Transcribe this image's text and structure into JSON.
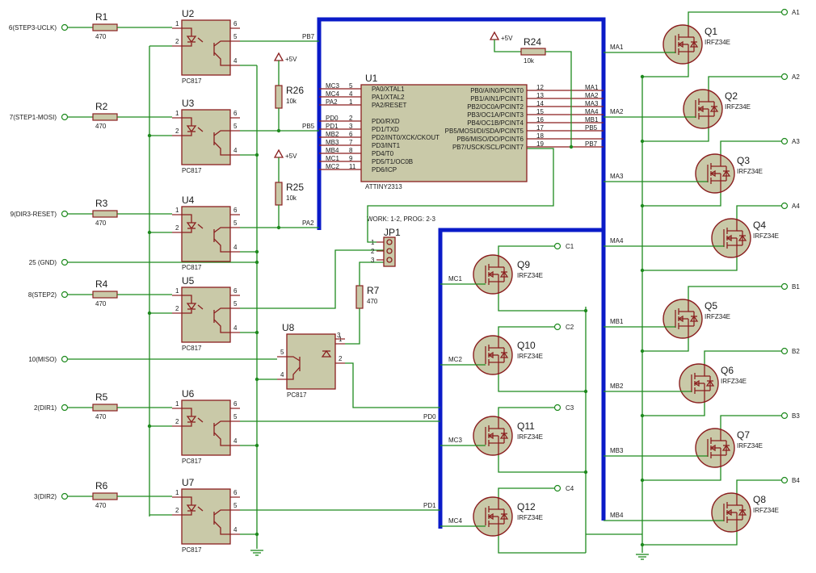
{
  "left_inputs": [
    "6(STEP3-UCLK)",
    "7(STEP1-MOSI)",
    "9(DIR3-RESET)",
    "25 (GND)",
    "8(STEP2)",
    "10(MISO)",
    "2(DIR1)",
    "3(DIR2)"
  ],
  "resistors": [
    {
      "ref": "R1",
      "value": "470"
    },
    {
      "ref": "R2",
      "value": "470"
    },
    {
      "ref": "R3",
      "value": "470"
    },
    {
      "ref": "R4",
      "value": "470"
    },
    {
      "ref": "R5",
      "value": "470"
    },
    {
      "ref": "R6",
      "value": "470"
    },
    {
      "ref": "R26",
      "value": "10k"
    },
    {
      "ref": "R25",
      "value": "10k"
    },
    {
      "ref": "R24",
      "value": "10k"
    },
    {
      "ref": "R7",
      "value": "470"
    }
  ],
  "optos": [
    {
      "ref": "U2",
      "part": "PC817"
    },
    {
      "ref": "U3",
      "part": "PC817"
    },
    {
      "ref": "U4",
      "part": "PC817"
    },
    {
      "ref": "U5",
      "part": "PC817"
    },
    {
      "ref": "U6",
      "part": "PC817"
    },
    {
      "ref": "U7",
      "part": "PC817"
    },
    {
      "ref": "U8",
      "part": "PC817"
    }
  ],
  "opto_pins": [
    "1",
    "2",
    "6",
    "5",
    "4",
    "3"
  ],
  "supply": "+5V",
  "mcu": {
    "ref": "U1",
    "part": "ATTINY2313",
    "left_pins": [
      {
        "net": "MC3",
        "num": "5",
        "name": "PA0/XTAL1"
      },
      {
        "net": "MC4",
        "num": "4",
        "name": "PA1/XTAL2"
      },
      {
        "net": "PA2",
        "num": "1",
        "name": "PA2/RESET"
      },
      {
        "net": "PD0",
        "num": "2",
        "name": "PD0/RXD"
      },
      {
        "net": "PD1",
        "num": "3",
        "name": "PD1/TXD"
      },
      {
        "net": "MB2",
        "num": "6",
        "name": "PD2/INT0/XCK/CKOUT"
      },
      {
        "net": "MB3",
        "num": "7",
        "name": "PD3/INT1"
      },
      {
        "net": "MB4",
        "num": "8",
        "name": "PD4/T0"
      },
      {
        "net": "MC1",
        "num": "9",
        "name": "PD5/T1/OC0B"
      },
      {
        "net": "MC2",
        "num": "11",
        "name": "PD6/ICP"
      }
    ],
    "right_pins": [
      {
        "num": "12",
        "name": "PB0/AIN0/PCINT0",
        "net": "MA1"
      },
      {
        "num": "13",
        "name": "PB1/AIN1/PCINT1",
        "net": "MA2"
      },
      {
        "num": "14",
        "name": "PB2/OC0A/PCINT2",
        "net": "MA3"
      },
      {
        "num": "15",
        "name": "PB3/OC1A/PCINT3",
        "net": "MA4"
      },
      {
        "num": "16",
        "name": "PB4/OC1B/PCINT4",
        "net": "MB1"
      },
      {
        "num": "17",
        "name": "PB5/MOSI/DI/SDA/PCINT5",
        "net": "PB5"
      },
      {
        "num": "18",
        "name": "PB6/MISO/DO/PCINT6",
        "net": ""
      },
      {
        "num": "19",
        "name": "PB7/USCK/SCL/PCINT7",
        "net": "PB7"
      }
    ]
  },
  "net_labels": {
    "pb7": "PB7",
    "pb5": "PB5",
    "pa2": "PA2",
    "pd0": "PD0",
    "pd1": "PD1"
  },
  "jumper": {
    "ref": "JP1",
    "note": "WORK: 1-2, PROG: 2-3",
    "pins": [
      "1",
      "2",
      "3"
    ]
  },
  "mosfets_right": [
    {
      "ref": "Q1",
      "part": "IRFZ34E",
      "gate": "MA1",
      "out": "A1"
    },
    {
      "ref": "Q2",
      "part": "IRFZ34E",
      "gate": "MA2",
      "out": "A2"
    },
    {
      "ref": "Q3",
      "part": "IRFZ34E",
      "gate": "MA3",
      "out": "A3"
    },
    {
      "ref": "Q4",
      "part": "IRFZ34E",
      "gate": "MA4",
      "out": "A4"
    },
    {
      "ref": "Q5",
      "part": "IRFZ34E",
      "gate": "MB1",
      "out": "B1"
    },
    {
      "ref": "Q6",
      "part": "IRFZ34E",
      "gate": "MB2",
      "out": "B2"
    },
    {
      "ref": "Q7",
      "part": "IRFZ34E",
      "gate": "MB3",
      "out": "B3"
    },
    {
      "ref": "Q8",
      "part": "IRFZ34E",
      "gate": "MB4",
      "out": "B4"
    }
  ],
  "mosfets_mid": [
    {
      "ref": "Q9",
      "part": "IRFZ34E",
      "gate": "MC1",
      "out": "C1"
    },
    {
      "ref": "Q10",
      "part": "IRFZ34E",
      "gate": "MC2",
      "out": "C2"
    },
    {
      "ref": "Q11",
      "part": "IRFZ34E",
      "gate": "MC3",
      "out": "C3"
    },
    {
      "ref": "Q12",
      "part": "IRFZ34E",
      "gate": "MC4",
      "out": "C4"
    }
  ]
}
